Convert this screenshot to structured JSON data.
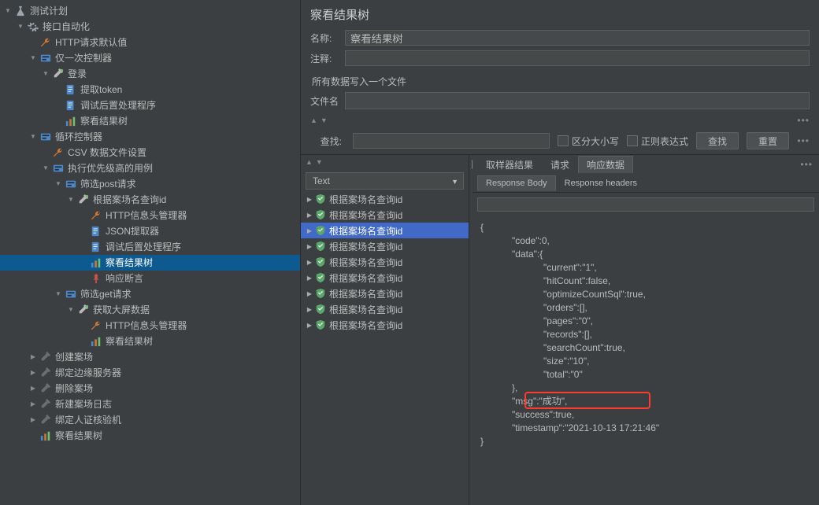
{
  "tree": [
    {
      "d": 0,
      "twist": "▾",
      "icon": "flask",
      "name": "test-plan",
      "label": "测试计划",
      "inter": true
    },
    {
      "d": 1,
      "twist": "▾",
      "icon": "gear",
      "name": "interface-automation",
      "label": "接口自动化",
      "inter": true
    },
    {
      "d": 2,
      "twist": "",
      "icon": "wrench",
      "name": "http-defaults",
      "label": "HTTP请求默认值",
      "inter": true
    },
    {
      "d": 2,
      "twist": "▾",
      "icon": "ctrl",
      "name": "once-controller",
      "label": "仅一次控制器",
      "inter": true
    },
    {
      "d": 3,
      "twist": "▾",
      "icon": "pipette",
      "name": "login",
      "label": "登录",
      "inter": true
    },
    {
      "d": 4,
      "twist": "",
      "icon": "doc",
      "name": "extract-token",
      "label": "提取token",
      "inter": true
    },
    {
      "d": 4,
      "twist": "",
      "icon": "doc",
      "name": "debug-post-processor",
      "label": "调试后置处理程序",
      "inter": true
    },
    {
      "d": 4,
      "twist": "",
      "icon": "chart",
      "name": "view-results-tree-1",
      "label": "察看结果树",
      "inter": true
    },
    {
      "d": 2,
      "twist": "▾",
      "icon": "ctrl",
      "name": "loop-controller",
      "label": "循环控制器",
      "inter": true
    },
    {
      "d": 3,
      "twist": "",
      "icon": "wrench",
      "name": "csv-config",
      "label": "CSV 数据文件设置",
      "inter": true
    },
    {
      "d": 3,
      "twist": "▾",
      "icon": "ctrl",
      "name": "priority-case",
      "label": "执行优先级高的用例",
      "inter": true
    },
    {
      "d": 4,
      "twist": "▾",
      "icon": "ctrl",
      "name": "filter-post-req",
      "label": "筛选post请求",
      "inter": true
    },
    {
      "d": 5,
      "twist": "▾",
      "icon": "pipette",
      "name": "query-id-by-name",
      "label": "根据案场名查询id",
      "inter": true
    },
    {
      "d": 6,
      "twist": "",
      "icon": "wrench",
      "name": "http-header-mgr",
      "label": "HTTP信息头管理器",
      "inter": true
    },
    {
      "d": 6,
      "twist": "",
      "icon": "doc",
      "name": "json-extractor",
      "label": "JSON提取器",
      "inter": true
    },
    {
      "d": 6,
      "twist": "",
      "icon": "doc",
      "name": "debug-post-processor-2",
      "label": "调试后置处理程序",
      "inter": true
    },
    {
      "d": 6,
      "twist": "",
      "icon": "chart",
      "name": "view-results-tree-2",
      "label": "察看结果树",
      "inter": true,
      "sel": true
    },
    {
      "d": 6,
      "twist": "",
      "icon": "pin",
      "name": "response-assertion",
      "label": "响应断言",
      "inter": true
    },
    {
      "d": 4,
      "twist": "▾",
      "icon": "ctrl",
      "name": "filter-get-req",
      "label": "筛选get请求",
      "inter": true
    },
    {
      "d": 5,
      "twist": "▾",
      "icon": "pipette",
      "name": "fetch-screen-data",
      "label": "获取大屏数据",
      "inter": true
    },
    {
      "d": 6,
      "twist": "",
      "icon": "wrench",
      "name": "http-header-mgr-2",
      "label": "HTTP信息头管理器",
      "inter": true
    },
    {
      "d": 6,
      "twist": "",
      "icon": "chart",
      "name": "view-results-tree-3",
      "label": "察看结果树",
      "inter": true
    },
    {
      "d": 2,
      "twist": "▸",
      "icon": "pipette-d",
      "name": "create-scene",
      "label": "创建案场",
      "inter": true
    },
    {
      "d": 2,
      "twist": "▸",
      "icon": "pipette-d",
      "name": "bind-edge-server",
      "label": "绑定边缘服务器",
      "inter": true
    },
    {
      "d": 2,
      "twist": "▸",
      "icon": "pipette-d",
      "name": "delete-scene",
      "label": "删除案场",
      "inter": true
    },
    {
      "d": 2,
      "twist": "▸",
      "icon": "pipette-d",
      "name": "new-scene-log",
      "label": "新建案场日志",
      "inter": true
    },
    {
      "d": 2,
      "twist": "▸",
      "icon": "pipette-d",
      "name": "bind-verify",
      "label": "绑定人证核验机",
      "inter": true
    },
    {
      "d": 2,
      "twist": "",
      "icon": "chart",
      "name": "view-results-tree-4",
      "label": "察看结果树",
      "inter": true
    }
  ],
  "panel": {
    "title": "察看结果树",
    "name_label": "名称:",
    "name_value": "察看结果树",
    "comment_label": "注释:",
    "file_section": "所有数据写入一个文件",
    "file_label": "文件名",
    "search_label": "查找:",
    "case_label": "区分大小写",
    "regex_label": "正则表达式",
    "search_btn": "查找",
    "reset_btn": "重置",
    "format_select": "Text",
    "tabs1": {
      "sampler": "取样器结果",
      "request": "请求",
      "response": "响应数据"
    },
    "tabs2": {
      "body": "Response Body",
      "headers": "Response headers"
    }
  },
  "results": [
    {
      "label": "根据案场名查询id"
    },
    {
      "label": "根据案场名查询id"
    },
    {
      "label": "根据案场名查询id",
      "sel": true
    },
    {
      "label": "根据案场名查询id"
    },
    {
      "label": "根据案场名查询id"
    },
    {
      "label": "根据案场名查询id"
    },
    {
      "label": "根据案场名查询id"
    },
    {
      "label": "根据案场名查询id"
    },
    {
      "label": "根据案场名查询id"
    }
  ],
  "response": {
    "lines": [
      "{",
      "            \"code\":0,",
      "            \"data\":{",
      "                        \"current\":\"1\",",
      "                        \"hitCount\":false,",
      "                        \"optimizeCountSql\":true,",
      "                        \"orders\":[],",
      "                        \"pages\":\"0\",",
      "                        \"records\":[],",
      "                        \"searchCount\":true,",
      "                        \"size\":\"10\",",
      "                        \"total\":\"0\"",
      "            },",
      "            \"msg\":\"成功\",",
      "            \"success\":true,",
      "            \"timestamp\":\"2021-10-13 17:21:46\"",
      "}"
    ]
  }
}
